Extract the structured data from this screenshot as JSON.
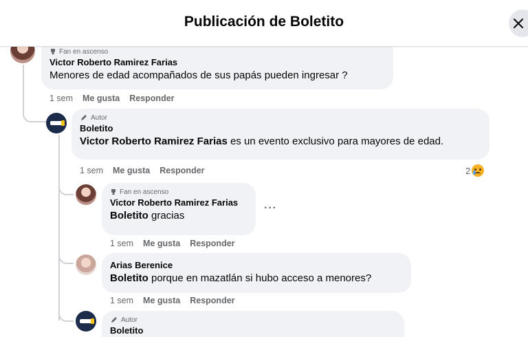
{
  "header": {
    "title": "Publicación de Boletito"
  },
  "labels": {
    "rising_fan": "Fan en ascenso",
    "author": "Autor"
  },
  "comments": [
    {
      "author": "Victor Roberto Ramirez Farias",
      "badge": "Fan en ascenso",
      "text": "Menores de edad acompañados de sus papás pueden ingresar ?",
      "time": "1 sem",
      "like": "Me gusta",
      "reply": "Responder"
    },
    {
      "author": "Boletito",
      "badge": "Autor",
      "mention": "Victor Roberto Ramirez Farias",
      "text": " es un evento exclusivo para mayores de edad.",
      "time": "1 sem",
      "like": "Me gusta",
      "reply": "Responder",
      "reaction_count": "2"
    },
    {
      "author": "Victor Roberto Ramirez Farias",
      "badge": "Fan en ascenso",
      "mention": "Boletito",
      "text": " gracias",
      "time": "1 sem",
      "like": "Me gusta",
      "reply": "Responder",
      "more": "···"
    },
    {
      "author": "Arias Berenice",
      "mention": "Boletito",
      "text": " porque en mazatlán si hubo acceso a menores?",
      "time": "1 sem",
      "like": "Me gusta",
      "reply": "Responder"
    },
    {
      "author": "Boletito",
      "badge": "Autor"
    }
  ],
  "colors": {
    "bubble": "#f0f2f5",
    "meta": "#65676b",
    "text": "#050505"
  }
}
